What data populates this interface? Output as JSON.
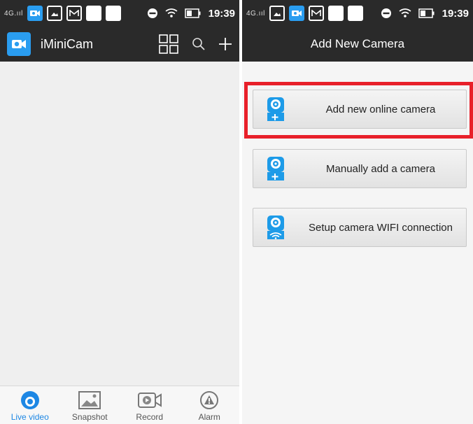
{
  "left": {
    "status": {
      "signal": "4G.ııl",
      "time": "19:39"
    },
    "app_title": "iMiniCam",
    "tabs": [
      {
        "label": "Live video",
        "icon": "live-video-icon",
        "active": true
      },
      {
        "label": "Snapshot",
        "icon": "image-icon",
        "active": false
      },
      {
        "label": "Record",
        "icon": "record-icon",
        "active": false
      },
      {
        "label": "Alarm",
        "icon": "alarm-icon",
        "active": false
      }
    ]
  },
  "right": {
    "status": {
      "signal": "4G.ııl",
      "time": "19:39"
    },
    "title": "Add New Camera",
    "buttons": [
      {
        "label": "Add new online camera",
        "icon": "camera-add-icon"
      },
      {
        "label": "Manually add a camera",
        "icon": "camera-add-icon"
      },
      {
        "label": "Setup camera WIFI connection",
        "icon": "camera-wifi-icon"
      }
    ]
  },
  "colors": {
    "bar_bg": "#2a2a2a",
    "accent_blue": "#2a9df0",
    "highlight_red": "#e8202a",
    "active_tab": "#1d87e4"
  }
}
